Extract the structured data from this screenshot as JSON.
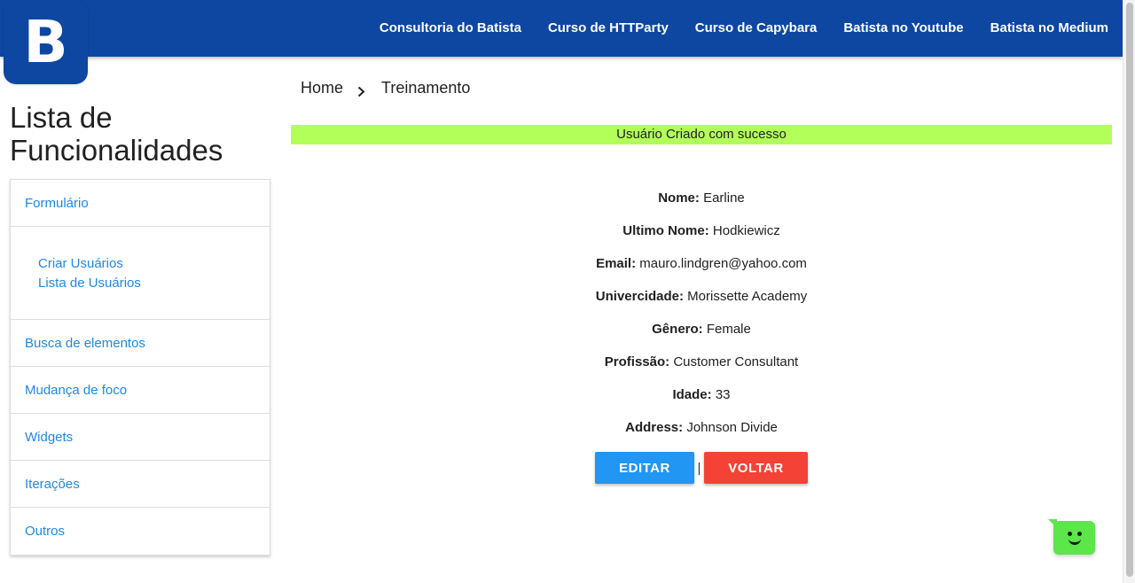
{
  "logo": {
    "letter": "B"
  },
  "nav": {
    "links": [
      "Consultoria do Batista",
      "Curso de HTTParty",
      "Curso de Capybara",
      "Batista no Youtube",
      "Batista no Medium"
    ]
  },
  "sidebar": {
    "title": "Lista de Funcionalidades",
    "items": {
      "formulario": "Formulário",
      "sub_criar": "Criar Usuários",
      "sub_lista": "Lista de Usuários",
      "busca": "Busca de elementos",
      "foco": "Mudança de foco",
      "widgets": "Widgets",
      "iteracoes": "Iterações",
      "outros": "Outros"
    }
  },
  "breadcrumb": {
    "home": "Home",
    "current": "Treinamento"
  },
  "banner": {
    "message": "Usuário Criado com sucesso"
  },
  "user": {
    "nome_label": "Nome:",
    "nome": "Earline",
    "ultimo_label": "Ultimo Nome:",
    "ultimo": "Hodkiewicz",
    "email_label": "Email:",
    "email": "mauro.lindgren@yahoo.com",
    "univ_label": "Univercidade:",
    "univ": "Morissette Academy",
    "genero_label": "Gênero:",
    "genero": "Female",
    "profissao_label": "Profissão:",
    "profissao": "Customer Consultant",
    "idade_label": "Idade:",
    "idade": "33",
    "address_label": "Address:",
    "address": "Johnson Divide"
  },
  "actions": {
    "edit": "EDITAR",
    "separator": "|",
    "back": "VOLTAR"
  },
  "colors": {
    "primary": "#0d47a1",
    "link": "#1e88e5",
    "banner": "#b2ff59",
    "edit_button": "#2196f3",
    "back_button": "#f44336",
    "chat_widget": "#5ce64a"
  },
  "icons": {
    "breadcrumb_separator": "chevron-right-icon",
    "chat": "chat-bubble-icon"
  }
}
